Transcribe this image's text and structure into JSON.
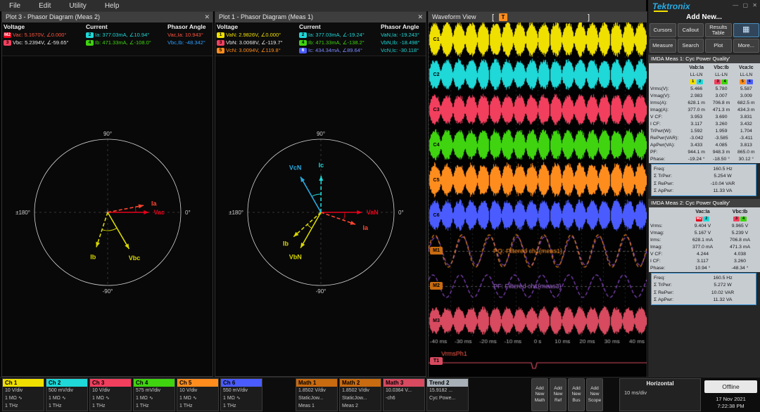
{
  "menu": {
    "items": [
      "File",
      "Edit",
      "Utility",
      "Help"
    ]
  },
  "window_controls": {
    "minimize": "—",
    "maximize": "▢",
    "close": "✕"
  },
  "plot3": {
    "title": "Plot 3 - Phasor Diagram (Meas 2)",
    "close": "✕",
    "headers": {
      "voltage": "Voltage",
      "current": "Current",
      "angle": "Phasor Angle"
    },
    "voltage": [
      {
        "chip": "M2",
        "chip_bg": "#e8001c",
        "chip_fg": "#ffffff",
        "text": "Vac: 5.1670V, ∠0.000°",
        "color": "#ff5540"
      },
      {
        "chip": "3",
        "chip_bg": "#f23f5e",
        "chip_fg": "#000000",
        "text": "Vbc: 5.2394V, ∠-59.65°",
        "color": "#e8e8e8"
      }
    ],
    "current": [
      {
        "chip": "2",
        "chip_bg": "#1fd8d8",
        "chip_fg": "#000000",
        "text": "Ia: 377.03mA, ∠10.94°",
        "color": "#1fd8d8"
      },
      {
        "chip": "4",
        "chip_bg": "#3fd40f",
        "chip_fg": "#000000",
        "text": "Ib: 471.33mA, ∠-108.0°",
        "color": "#3fd40f"
      }
    ],
    "angles": [
      {
        "text": "Vac,Ia: 10.943°",
        "color": "#ff5540"
      },
      {
        "text": "Vbc,Ib: -48.342°",
        "color": "#2f9fff"
      }
    ],
    "axis": {
      "top": "90°",
      "left": "±180°",
      "bottom": "-90°",
      "right": "0°"
    },
    "phasors": [
      {
        "name": "Vac",
        "angle": 0,
        "len": 0.56,
        "color": "#e8001c",
        "dashed": false
      },
      {
        "name": "Ia",
        "angle": 10.94,
        "len": 0.5,
        "color": "#ff4530",
        "dashed": true
      },
      {
        "name": "Vbc",
        "angle": -59.65,
        "len": 0.58,
        "color": "#d8d800",
        "dashed": false
      },
      {
        "name": "Ib",
        "angle": -108.0,
        "len": 0.5,
        "color": "#d8d800",
        "dashed": true
      }
    ],
    "arcs": [
      {
        "a1": 0,
        "a2": 10.94,
        "r": 40,
        "color": "#e8001c"
      },
      {
        "a1": -59.65,
        "a2": -108.0,
        "r": 26,
        "color": "#d8d800"
      }
    ]
  },
  "plot1": {
    "title": "Plot 1 - Phasor Diagram (Meas 1)",
    "close": "✕",
    "headers": {
      "voltage": "Voltage",
      "current": "Current",
      "angle": "Phasor Angle"
    },
    "voltage": [
      {
        "chip": "1",
        "chip_bg": "#f0e000",
        "chip_fg": "#000000",
        "text": "VaN: 2.9826V, ∠0.000°",
        "color": "#f0e000"
      },
      {
        "chip": "3",
        "chip_bg": "#f23f5e",
        "chip_fg": "#000000",
        "text": "VbN: 3.0068V, ∠-119.7°",
        "color": "#e8e8e8"
      },
      {
        "chip": "5",
        "chip_bg": "#ff8d1e",
        "chip_fg": "#000000",
        "text": "VcN: 3.0094V, ∠119.8°",
        "color": "#ff8d1e"
      }
    ],
    "current": [
      {
        "chip": "2",
        "chip_bg": "#1fd8d8",
        "chip_fg": "#000000",
        "text": "Ia: 377.03mA, ∠-19.24°",
        "color": "#1fd8d8"
      },
      {
        "chip": "4",
        "chip_bg": "#3fd40f",
        "chip_fg": "#000000",
        "text": "Ib: 471.33mA, ∠-138.2°",
        "color": "#3fd40f"
      },
      {
        "chip": "6",
        "chip_bg": "#4a5cff",
        "chip_fg": "#ffffff",
        "text": "Ic: 434.34mA, ∠89.64°",
        "color": "#7a8aff"
      }
    ],
    "angles": [
      {
        "text": "VaN,Ia: -19.243°",
        "color": "#1fd8d8"
      },
      {
        "text": "VbN,Ib: -18.498°",
        "color": "#1fd8d8"
      },
      {
        "text": "VcN,Ic: -30.118°",
        "color": "#1fd8d8"
      }
    ],
    "axis": {
      "top": "90°",
      "left": "±180°",
      "bottom": "-90°",
      "right": "0°"
    },
    "phasors": [
      {
        "name": "VaN",
        "angle": 0,
        "len": 0.56,
        "color": "#e8001c",
        "dashed": false
      },
      {
        "name": "Ia",
        "angle": -19.24,
        "len": 0.5,
        "color": "#ff4530",
        "dashed": true
      },
      {
        "name": "VbN",
        "angle": -119.7,
        "len": 0.56,
        "color": "#d8d800",
        "dashed": false
      },
      {
        "name": "Ib",
        "angle": -138.2,
        "len": 0.5,
        "color": "#d8d800",
        "dashed": true
      },
      {
        "name": "VcN",
        "angle": 119.8,
        "len": 0.56,
        "color": "#29abe2",
        "dashed": false
      },
      {
        "name": "Ic",
        "angle": 89.64,
        "len": 0.5,
        "color": "#1fd8d8",
        "dashed": true
      }
    ],
    "arcs": [
      {
        "a1": 0,
        "a2": -19.24,
        "r": 34,
        "color": "#e8001c"
      },
      {
        "a1": -119.7,
        "a2": -138.2,
        "r": 26,
        "color": "#d8d800"
      },
      {
        "a1": 119.8,
        "a2": 89.64,
        "r": 26,
        "color": "#1fd8d8"
      }
    ]
  },
  "waveform": {
    "title": "Waveform View",
    "trigger": "T",
    "bracket_left": "[",
    "bracket_right": "]",
    "lanes": [
      {
        "chip": "C1",
        "color": "#f0e000",
        "type": "burst",
        "amp": 23
      },
      {
        "chip": "C2",
        "color": "#1fd8d8",
        "type": "burst",
        "amp": 20
      },
      {
        "chip": "C3",
        "color": "#f23f5e",
        "type": "burst",
        "amp": 20
      },
      {
        "chip": "C4",
        "color": "#3fd40f",
        "type": "burst",
        "amp": 20
      },
      {
        "chip": "C5",
        "color": "#ff8d1e",
        "type": "burst",
        "amp": 22
      },
      {
        "chip": "C6",
        "color": "#4a5cff",
        "type": "burst",
        "amp": 20
      },
      {
        "chip": "M1",
        "color": "#c96b10",
        "type": "sine",
        "amp": 20,
        "label": "PQ: Filtered ch1(meas1)",
        "label_color": "#ff8d1e"
      },
      {
        "chip": "M2",
        "color": "#c96b10",
        "type": "sine2",
        "amp": 16,
        "label": "PF: Filtered ch1(meas3)",
        "label_color": "#a86be0"
      },
      {
        "chip": "M3",
        "color": "#d84a5f",
        "type": "burst",
        "amp": 18
      },
      {
        "chip": "T1",
        "color": "#d84a5f",
        "type": "trend",
        "amp": 8,
        "label": "VrmsPh1",
        "label_color": "#ff5a4a"
      }
    ],
    "time_labels": [
      "-40 ms",
      "-30 ms",
      "-20 ms",
      "-10 ms",
      "0 s",
      "10 ms",
      "20 ms",
      "30 ms",
      "40 ms"
    ]
  },
  "right_panel": {
    "brand": "Tektronix",
    "add_new": "Add New...",
    "buttons": [
      {
        "label": "Cursors"
      },
      {
        "label": "Callout"
      },
      {
        "label": "Results Table"
      },
      {
        "label": "▦",
        "icon": true
      },
      {
        "label": "Measure"
      },
      {
        "label": "Search"
      },
      {
        "label": "Plot"
      },
      {
        "label": "More..."
      }
    ]
  },
  "meas1": {
    "title": "IMDA Meas 1: Cyc Power Quality'",
    "col_headers": [
      "Vab:Ia",
      "Vbc:Ib",
      "Vca:Ic"
    ],
    "sub_headers": [
      "LL-LN",
      "LL-LN",
      "LL-LN"
    ],
    "chips": [
      [
        {
          "t": "1",
          "bg": "#f0e000"
        },
        {
          "t": "2",
          "bg": "#1fd8d8"
        }
      ],
      [
        {
          "t": "3",
          "bg": "#f23f5e"
        },
        {
          "t": "4",
          "bg": "#3fd40f"
        }
      ],
      [
        {
          "t": "5",
          "bg": "#ff8d1e"
        },
        {
          "t": "6",
          "bg": "#4a5cff"
        }
      ]
    ],
    "rows": [
      {
        "label": "Vrms(V):",
        "values": [
          "5.466",
          "5.780",
          "5.587"
        ]
      },
      {
        "label": "Vmag(V):",
        "values": [
          "2.983",
          "3.007",
          "3.009"
        ]
      },
      {
        "label": "Irms(A):",
        "values": [
          "628.1 m",
          "706.8 m",
          "682.5 m"
        ]
      },
      {
        "label": "Imag(A):",
        "values": [
          "377.0 m",
          "471.3 m",
          "434.3 m"
        ]
      },
      {
        "label": "V CF:",
        "values": [
          "3.953",
          "3.690",
          "3.831"
        ]
      },
      {
        "label": "I CF:",
        "values": [
          "3.117",
          "3.260",
          "3.432"
        ]
      },
      {
        "label": "TrPwr(W):",
        "values": [
          "1.592",
          "1.959",
          "1.704"
        ]
      },
      {
        "label": "RePwr(VAR):",
        "values": [
          "-3.042",
          "-3.585",
          "-3.411"
        ]
      },
      {
        "label": "ApPwr(VA):",
        "values": [
          "3.433",
          "4.085",
          "3.813"
        ]
      },
      {
        "label": "PF:",
        "values": [
          "944.1 m",
          "948.3 m",
          "865.0 m"
        ]
      },
      {
        "label": "Phase:",
        "values": [
          "-19.24 °",
          "-18.50 °",
          "30.12 °"
        ]
      }
    ],
    "summary": [
      {
        "label": "Freq:",
        "value": "160.5 Hz"
      },
      {
        "label": "Σ TrPwr:",
        "value": "5.254 W"
      },
      {
        "label": "Σ RePwr:",
        "value": "-10.04 VAR"
      },
      {
        "label": "Σ ApPwr:",
        "value": "11.33 VA"
      }
    ]
  },
  "meas2": {
    "title": "IMDA Meas 2: Cyc Power Quality'",
    "col_headers": [
      "Vac:Ia",
      "Vbc:Ib"
    ],
    "chips": [
      [
        {
          "t": "M2",
          "bg": "#e8001c",
          "fg": "#ffffff"
        },
        {
          "t": "2",
          "bg": "#1fd8d8"
        }
      ],
      [
        {
          "t": "3",
          "bg": "#f23f5e"
        },
        {
          "t": "4",
          "bg": "#3fd40f"
        }
      ]
    ],
    "rows": [
      {
        "label": "Vrms:",
        "values": [
          "9.404 V",
          "9.965 V"
        ]
      },
      {
        "label": "Vmag:",
        "values": [
          "5.167 V",
          "5.239 V"
        ]
      },
      {
        "label": "Irms:",
        "values": [
          "628.1 mA",
          "706.8 mA"
        ]
      },
      {
        "label": "Imag:",
        "values": [
          "377.0 mA",
          "471.3 mA"
        ]
      },
      {
        "label": "V CF:",
        "values": [
          "4.244",
          "4.038"
        ]
      },
      {
        "label": "I CF:",
        "values": [
          "3.117",
          "3.260"
        ]
      },
      {
        "label": "Phase:",
        "values": [
          "10.94 °",
          "-48.34 °"
        ]
      }
    ],
    "summary": [
      {
        "label": "Freq:",
        "value": "160.5 Hz"
      },
      {
        "label": "Σ TrPwr:",
        "value": "5.272 W"
      },
      {
        "label": "Σ RePwr:",
        "value": "10.02 VAR"
      },
      {
        "label": "Σ ApPwr:",
        "value": "11.32 VA"
      }
    ]
  },
  "bottom": {
    "channels": [
      {
        "label": "Ch 1",
        "color": "#f0e000",
        "lines": [
          "10 V/div",
          "1 MΩ ∿",
          "1 THz"
        ]
      },
      {
        "label": "Ch 2",
        "color": "#1fd8d8",
        "lines": [
          "500 mV/div",
          "1 MΩ ∿",
          "1 THz"
        ]
      },
      {
        "label": "Ch 3",
        "color": "#f23f5e",
        "lines": [
          "10 V/div",
          "1 MΩ ∿",
          "1 THz"
        ]
      },
      {
        "label": "Ch 4",
        "color": "#3fd40f",
        "lines": [
          "575 mV/div",
          "1 MΩ ∿",
          "1 THz"
        ]
      },
      {
        "label": "Ch 5",
        "color": "#ff8d1e",
        "lines": [
          "10 V/div",
          "1 MΩ ∿",
          "1 THz"
        ]
      },
      {
        "label": "Ch 6",
        "color": "#4a5cff",
        "lines": [
          "550 mV/div",
          "1 MΩ ∿",
          "1 THz"
        ]
      }
    ],
    "maths": [
      {
        "label": "Math 1",
        "color": "#c96b10",
        "lines": [
          "1.8502 V/div",
          "StaticJow...",
          "Meas 1"
        ]
      },
      {
        "label": "Math 2",
        "color": "#c96b10",
        "lines": [
          "1.8502 V/div",
          "StaticJow...",
          "Meas 2"
        ]
      },
      {
        "label": "Math 3",
        "color": "#d84a5f",
        "lines": [
          "10.0364 V...",
          "-ch6",
          ""
        ]
      },
      {
        "label": "Trend 2",
        "color": "#a8b0b8",
        "lines": [
          "15.9182 ...",
          "Cyc Powe...",
          ""
        ]
      }
    ],
    "add_buttons": [
      {
        "lines": [
          "Add",
          "New",
          "Math"
        ]
      },
      {
        "lines": [
          "Add",
          "New",
          "Ref"
        ]
      },
      {
        "lines": [
          "Add",
          "New",
          "Bus"
        ]
      },
      {
        "lines": [
          "Add",
          "New",
          "Scope"
        ]
      }
    ],
    "horizontal": {
      "title": "Horizontal",
      "value": "10 ms/div"
    },
    "offline": "Offline",
    "date": "17 Nov 2021",
    "time": "7:22:38 PM"
  }
}
